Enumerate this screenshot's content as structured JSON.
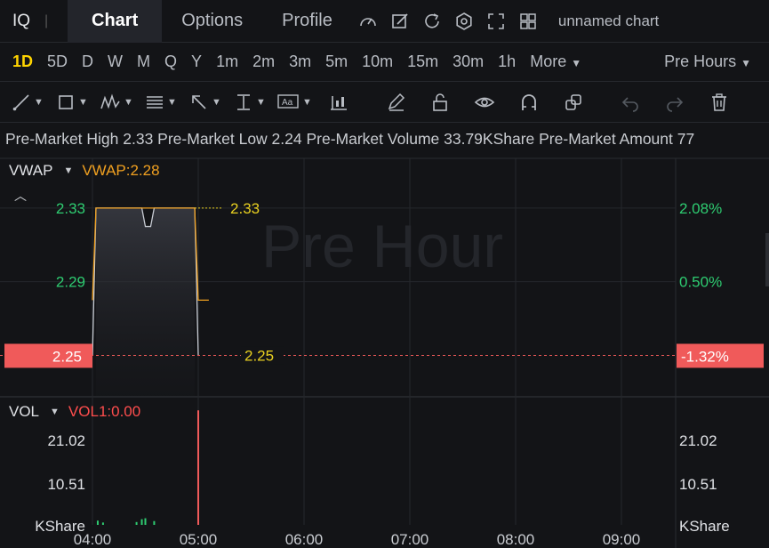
{
  "header": {
    "symbol": "IQ",
    "separator": "|",
    "tabs": [
      {
        "label": "Chart",
        "active": true
      },
      {
        "label": "Options",
        "active": false
      },
      {
        "label": "Profile",
        "active": false
      }
    ],
    "icons": [
      "gauge-icon",
      "edit-icon",
      "refresh-icon",
      "settings-icon",
      "fullscreen-icon",
      "layout-grid-icon"
    ],
    "chart_name": "unnamed chart"
  },
  "intervals": {
    "items": [
      "1D",
      "5D",
      "D",
      "W",
      "M",
      "Q",
      "Y",
      "1m",
      "2m",
      "3m",
      "5m",
      "10m",
      "15m",
      "30m",
      "1h"
    ],
    "active": "1D",
    "more_label": "More",
    "session_label": "Pre Hours"
  },
  "tools": [
    "trendline-icon",
    "rectangle-icon",
    "pattern-icon",
    "fib-icon",
    "arrow-icon",
    "measure-icon",
    "text-icon",
    "indicator-icon",
    "pencil-icon",
    "unlock-icon",
    "eye-icon",
    "magnet-icon",
    "clone-icon",
    "undo-icon",
    "redo-icon",
    "trash-icon"
  ],
  "info_line": "Pre-Market High 2.33 Pre-Market Low 2.24 Pre-Market Volume 33.79KShare Pre-Market Amount 77",
  "watermark": "Pre Hour",
  "colors": {
    "up": "#2ecc71",
    "down": "#f05a5a",
    "vwap": "#f0a020",
    "price_line": "#c8ccd4",
    "label_yellow": "#e8d020"
  },
  "price_panel": {
    "indicator_name": "VWAP",
    "indicator_value": "VWAP:2.28",
    "left_ticks": [
      "2.33",
      "2.29"
    ],
    "right_ticks": [
      "2.08%",
      "0.50%"
    ],
    "current_price": "2.25",
    "current_pct": "-1.32%",
    "high_label": "2.33",
    "last_label": "2.25"
  },
  "volume_panel": {
    "indicator_name": "VOL",
    "indicator_value": "VOL1:0.00",
    "left_ticks": [
      "21.02",
      "10.51",
      "KShare"
    ],
    "right_ticks": [
      "21.02",
      "10.51",
      "KShare"
    ]
  },
  "time_axis": [
    "04:00",
    "05:00",
    "06:00",
    "07:00",
    "08:00",
    "09:00"
  ],
  "chart_data": {
    "type": "line",
    "price_ylim": [
      2.228,
      2.357
    ],
    "price_series": [
      {
        "t": "04:00",
        "v": 2.25
      },
      {
        "t": "04:02",
        "v": 2.33
      },
      {
        "t": "04:08",
        "v": 2.33
      },
      {
        "t": "04:20",
        "v": 2.33
      },
      {
        "t": "04:28",
        "v": 2.33
      },
      {
        "t": "04:30",
        "v": 2.32
      },
      {
        "t": "04:33",
        "v": 2.32
      },
      {
        "t": "04:35",
        "v": 2.33
      },
      {
        "t": "04:58",
        "v": 2.33
      },
      {
        "t": "05:00",
        "v": 2.25
      }
    ],
    "vwap_series": [
      {
        "t": "04:00",
        "v": 2.28
      },
      {
        "t": "04:02",
        "v": 2.33
      },
      {
        "t": "04:30",
        "v": 2.33
      },
      {
        "t": "04:58",
        "v": 2.33
      },
      {
        "t": "05:00",
        "v": 2.28
      },
      {
        "t": "05:06",
        "v": 2.28
      }
    ],
    "volume_ylim": [
      0,
      25
    ],
    "volume_bars": [
      {
        "t": "04:03",
        "v": 0.9,
        "up": true
      },
      {
        "t": "04:06",
        "v": 0.5,
        "up": true
      },
      {
        "t": "04:25",
        "v": 0.6,
        "up": true
      },
      {
        "t": "04:28",
        "v": 1.2,
        "up": true
      },
      {
        "t": "04:30",
        "v": 1.4,
        "up": true
      },
      {
        "t": "04:35",
        "v": 0.8,
        "up": true
      },
      {
        "t": "05:00",
        "v": 24.2,
        "up": false
      }
    ]
  }
}
